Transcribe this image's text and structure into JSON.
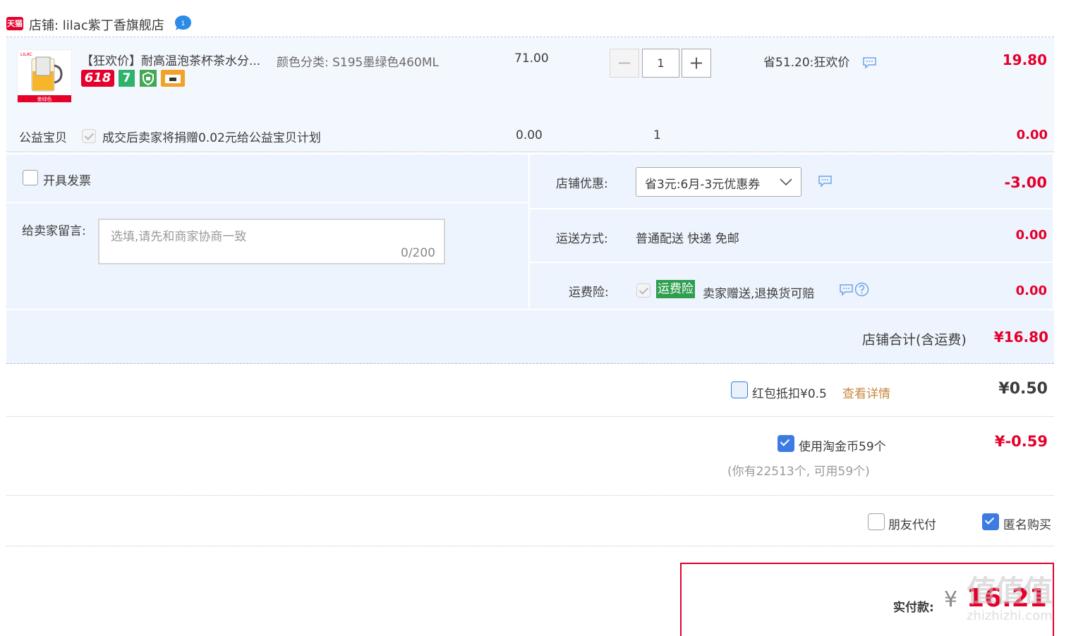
{
  "shop": {
    "tag": "天猫",
    "name": "店铺: lilac紫丁香旗舰店",
    "wangwang": "1"
  },
  "item": {
    "title": "【狂欢价】耐高温泡茶杯茶水分...",
    "sku": "颜色分类: S195墨绿色460ML",
    "price": "71.00",
    "quantity": "1",
    "promo": "省51.20:狂欢价",
    "subtotal": "19.80",
    "thumb_caption": "墨绿色",
    "badge_618": "618",
    "badge_7": "7"
  },
  "charity": {
    "label": "公益宝贝",
    "text": "成交后卖家将捐赠0.02元给公益宝贝计划",
    "price": "0.00",
    "quantity": "1",
    "subtotal": "0.00"
  },
  "invoice": {
    "label": "开具发票"
  },
  "message": {
    "label": "给卖家留言:",
    "placeholder": "选填,请先和商家协商一致",
    "counter": "0/200"
  },
  "shop_discount": {
    "label": "店铺优惠:",
    "selected": "省3元:6月-3元优惠券",
    "amount": "-3.00"
  },
  "shipping": {
    "label": "运送方式:",
    "value": "普通配送 快递 免邮",
    "amount": "0.00"
  },
  "insurance": {
    "label": "运费险:",
    "tag": "运费险",
    "text": "卖家赠送,退换货可赔",
    "amount": "0.00"
  },
  "shop_total": {
    "label": "店铺合计(含运费)",
    "amount": "¥16.80"
  },
  "red_packet": {
    "label": "红包抵扣¥0.5",
    "link": "查看详情",
    "amount": "¥0.50"
  },
  "coins": {
    "label": "使用淘金币59个",
    "note": "(你有22513个, 可用59个)",
    "amount": "¥-0.59"
  },
  "options": {
    "friend_pay": "朋友代付",
    "anonymous": "匿名购买"
  },
  "actual": {
    "label": "实付款:",
    "currency": "¥",
    "amount": "16.21"
  },
  "watermark": {
    "line1": "值值值",
    "line2": "zhizhizhi.com"
  },
  "colors": {
    "accent": "#e4002b",
    "blue": "#3d7be3",
    "green": "#2e9e4f",
    "link": "#c8863e"
  }
}
